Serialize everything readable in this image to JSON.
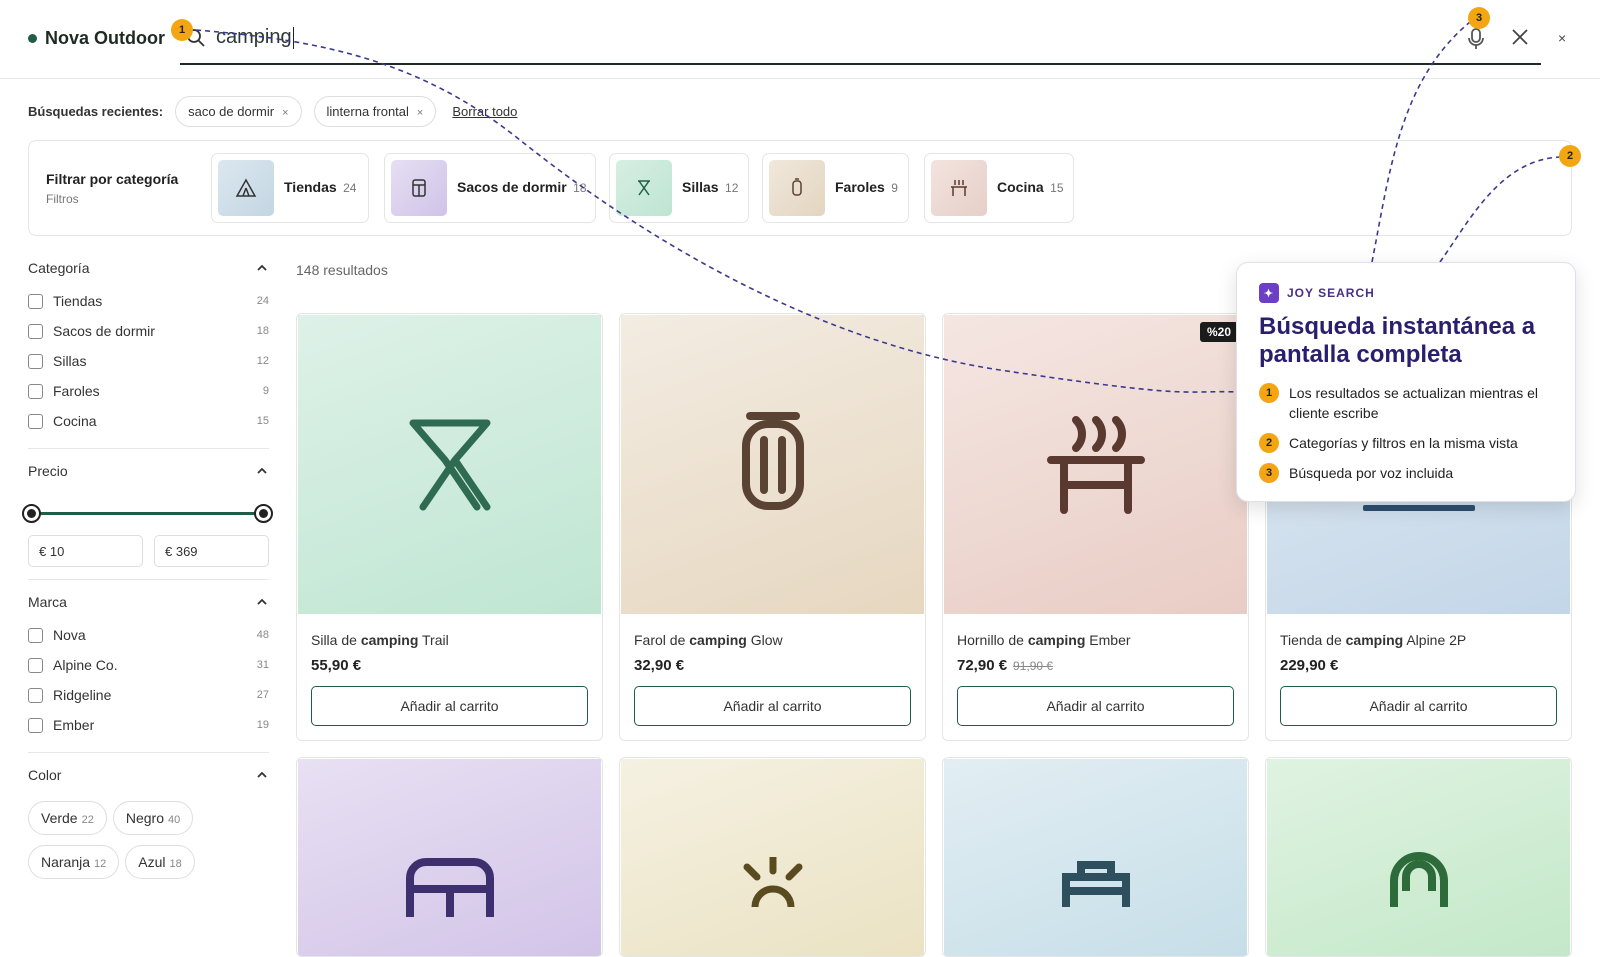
{
  "header": {
    "brand": "Nova Outdoor",
    "search_value": "camping"
  },
  "recent": {
    "label": "Búsquedas recientes:",
    "items": [
      "saco de dormir",
      "linterna frontal"
    ],
    "clear": "Borrar todo"
  },
  "categories": {
    "title": "Filtrar por categoría",
    "subtitle": "Filtros",
    "items": [
      {
        "name": "Tiendas",
        "count": "24"
      },
      {
        "name": "Sacos de dormir",
        "count": "18"
      },
      {
        "name": "Sillas",
        "count": "12"
      },
      {
        "name": "Faroles",
        "count": "9"
      },
      {
        "name": "Cocina",
        "count": "15"
      }
    ]
  },
  "sidebar": {
    "category": {
      "title": "Categoría",
      "items": [
        {
          "label": "Tiendas",
          "count": "24"
        },
        {
          "label": "Sacos de dormir",
          "count": "18"
        },
        {
          "label": "Sillas",
          "count": "12"
        },
        {
          "label": "Faroles",
          "count": "9"
        },
        {
          "label": "Cocina",
          "count": "15"
        }
      ]
    },
    "price": {
      "title": "Precio",
      "min": "€ 10",
      "max": "€ 369"
    },
    "brand": {
      "title": "Marca",
      "items": [
        {
          "label": "Nova",
          "count": "48"
        },
        {
          "label": "Alpine Co.",
          "count": "31"
        },
        {
          "label": "Ridgeline",
          "count": "27"
        },
        {
          "label": "Ember",
          "count": "19"
        }
      ]
    },
    "color": {
      "title": "Color",
      "items": [
        {
          "label": "Verde",
          "count": "22"
        },
        {
          "label": "Negro",
          "count": "40"
        },
        {
          "label": "Naranja",
          "count": "12"
        },
        {
          "label": "Azul",
          "count": "18"
        }
      ]
    }
  },
  "results": {
    "count": "148 resultados"
  },
  "products": [
    {
      "pre": "Silla de ",
      "kw": "camping",
      "post": " Trail",
      "price": "55,90 €",
      "old": "",
      "btn": "Añadir al carrito"
    },
    {
      "pre": "Farol de ",
      "kw": "camping",
      "post": " Glow",
      "price": "32,90 €",
      "old": "",
      "btn": "Añadir al carrito"
    },
    {
      "pre": "Hornillo de ",
      "kw": "camping",
      "post": " Ember",
      "price": "72,90 €",
      "old": "91,90 €",
      "btn": "Añadir al carrito"
    },
    {
      "pre": "Tienda de ",
      "kw": "camping",
      "post": " Alpine 2P",
      "price": "229,90 €",
      "old": "",
      "btn": "Añadir al carrito"
    }
  ],
  "discount": "%20",
  "callout": {
    "brand": "JOY SEARCH",
    "title": "Búsqueda instantánea a pantalla completa",
    "bullets": [
      {
        "n": "1",
        "text": "Los resultados se actualizan mientras el cliente escribe"
      },
      {
        "n": "2",
        "text": "Categorías y filtros en la misma vista"
      },
      {
        "n": "3",
        "text": "Búsqueda por voz incluida"
      }
    ]
  },
  "markers": [
    "1",
    "2",
    "3"
  ],
  "colors": {
    "accent": "#1f5e45",
    "callout_title": "#2a1e6e",
    "marker": "#f3a612"
  }
}
